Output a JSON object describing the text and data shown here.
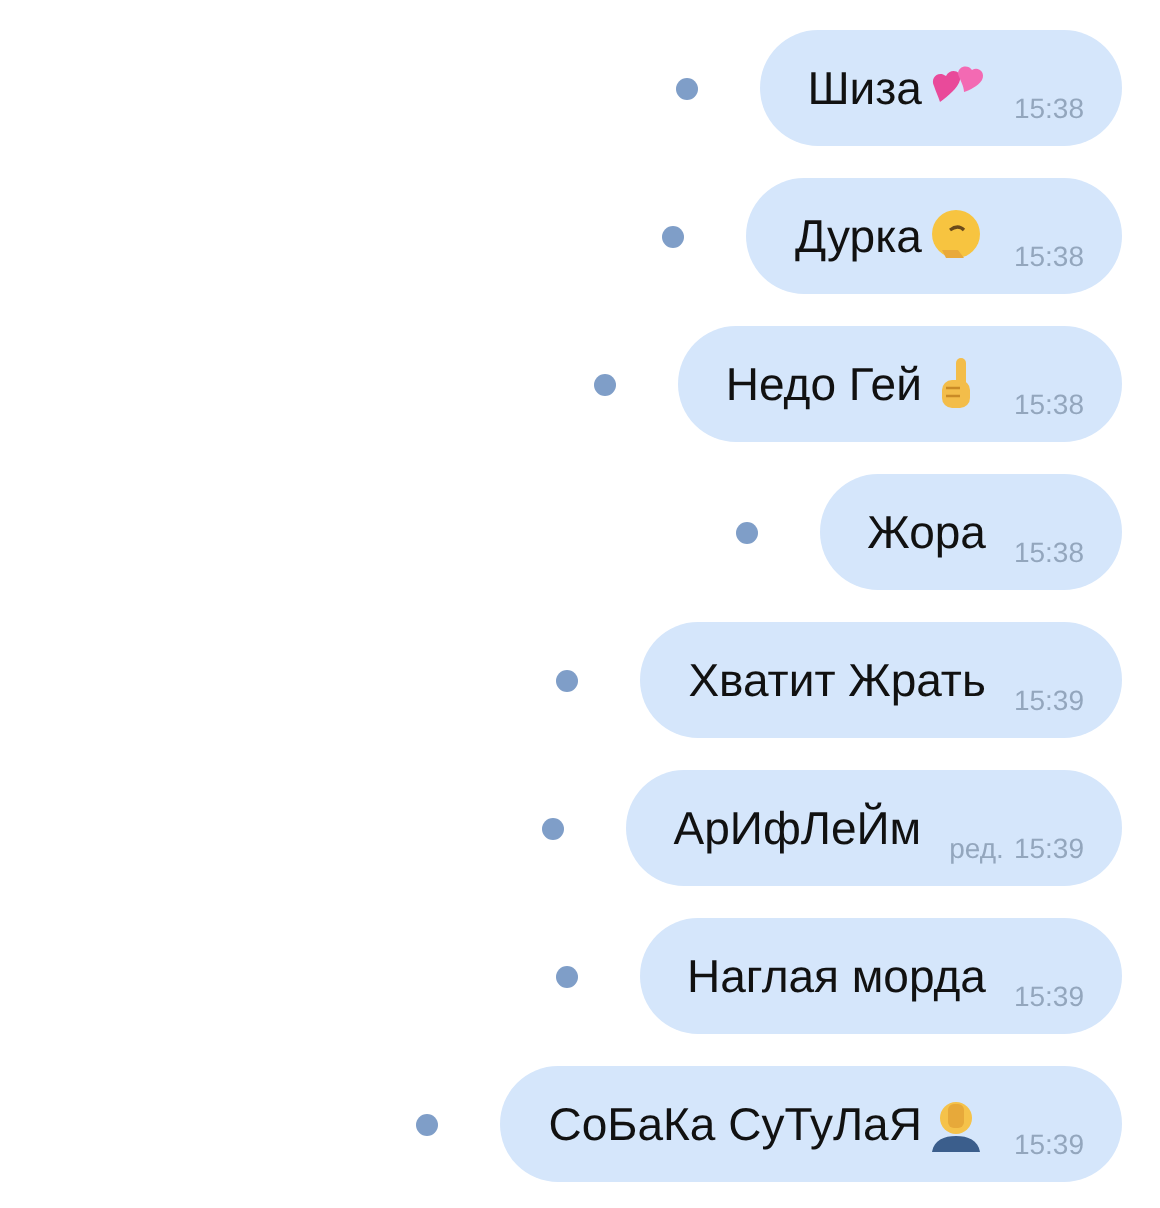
{
  "messages": [
    {
      "text": "Шиза",
      "kind": "hearts",
      "time": "15:38",
      "unread": true
    },
    {
      "text": "Дурка",
      "kind": "thinking",
      "time": "15:38",
      "unread": true
    },
    {
      "text": "Недо Гей",
      "kind": "point-up",
      "time": "15:38",
      "unread": true
    },
    {
      "text": "Жора",
      "kind": "plain",
      "time": "15:38",
      "unread": true
    },
    {
      "text": "Хватит Жрать",
      "kind": "plain",
      "time": "15:39",
      "unread": true
    },
    {
      "text": "АрИфЛеЙм",
      "kind": "plain",
      "edited_label": "ред.",
      "time": "15:39",
      "unread": true
    },
    {
      "text": "Наглая морда",
      "kind": "plain",
      "time": "15:39",
      "unread": true
    },
    {
      "text": "СоБаКа СуТуЛаЯ",
      "kind": "facepalm",
      "time": "15:39",
      "unread": true
    }
  ]
}
